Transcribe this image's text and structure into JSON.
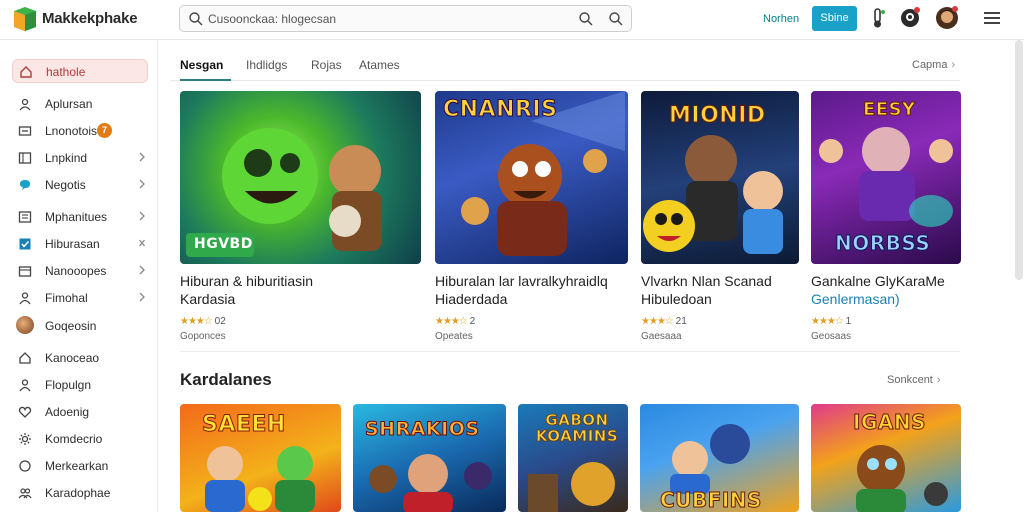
{
  "app": {
    "brand": "Makkekphake",
    "search_text": "Cusoonckaa: hlogecsan",
    "top_link": "Norhen",
    "top_button": "Sbine"
  },
  "colors": {
    "accent": "#1aa1c8",
    "active_bg": "#fbe7e6",
    "star": "#e2a020",
    "tab_underline": "#2a7f82"
  },
  "sidebar": {
    "items": [
      {
        "label": "hathole",
        "icon": "home-icon"
      },
      {
        "label": "Aplursan",
        "icon": "user-icon"
      },
      {
        "label": "Lnonotois",
        "icon": "inbox-icon",
        "badge": "7"
      },
      {
        "label": "Lnpkind",
        "icon": "grid-icon"
      },
      {
        "label": "Negotis",
        "icon": "chat-icon"
      },
      {
        "label": "Mphanitues",
        "icon": "list-icon"
      },
      {
        "label": "Hiburasan",
        "icon": "checkbox-icon"
      },
      {
        "label": "Nanooopes",
        "icon": "folder-icon"
      },
      {
        "label": "Fimohal",
        "icon": "person-icon"
      },
      {
        "label": "Goqeosin",
        "icon": "avatar-icon"
      },
      {
        "label": "Kanoceao",
        "icon": "monitor-icon"
      },
      {
        "label": "Flopulgn",
        "icon": "profile-icon"
      },
      {
        "label": "Adoenig",
        "icon": "heart-icon"
      },
      {
        "label": "Komdecrio",
        "icon": "settings-icon"
      },
      {
        "label": "Merkearkan",
        "icon": "circle-icon"
      },
      {
        "label": "Karadophae",
        "icon": "people-icon"
      }
    ]
  },
  "tabs": [
    {
      "label": "Nesgan"
    },
    {
      "label": "Ihdlidgs"
    },
    {
      "label": "Rojas"
    },
    {
      "label": "Atames"
    }
  ],
  "section1": {
    "see_more": "Capma",
    "cards": [
      {
        "title": "Hiburan & hiburitiasin",
        "title2": "Kardasia",
        "rating": "02",
        "meta": "Goponces",
        "thumb_text": "HGVBD"
      },
      {
        "title": "Hiburalan lar lavralkyhraidlq",
        "title2": "Hiaderdada",
        "rating": "2",
        "meta": "Opeates",
        "thumb_text": "CNANRIS"
      },
      {
        "title": "Vlvarkn Nlan Scanad",
        "title2": "Hibuledoan",
        "rating": "21",
        "meta": "Gaesaaa",
        "thumb_text": "MIONID"
      },
      {
        "title": "Gankalne GlyKaraMe",
        "title2": "Genlermasan)",
        "rating": "1",
        "meta": "Geosaas",
        "thumb_text": "NORBSS",
        "thumb_top": "EESY"
      }
    ]
  },
  "section2": {
    "title": "Kardalanes",
    "see_more": "Sonkcent",
    "cards": [
      {
        "thumb_text": "SAEEH"
      },
      {
        "thumb_text": "SHRAKIOS"
      },
      {
        "thumb_text": "GABON KOAMINS"
      },
      {
        "thumb_text": "CUBFINS"
      },
      {
        "thumb_text": "IGANS"
      }
    ]
  }
}
